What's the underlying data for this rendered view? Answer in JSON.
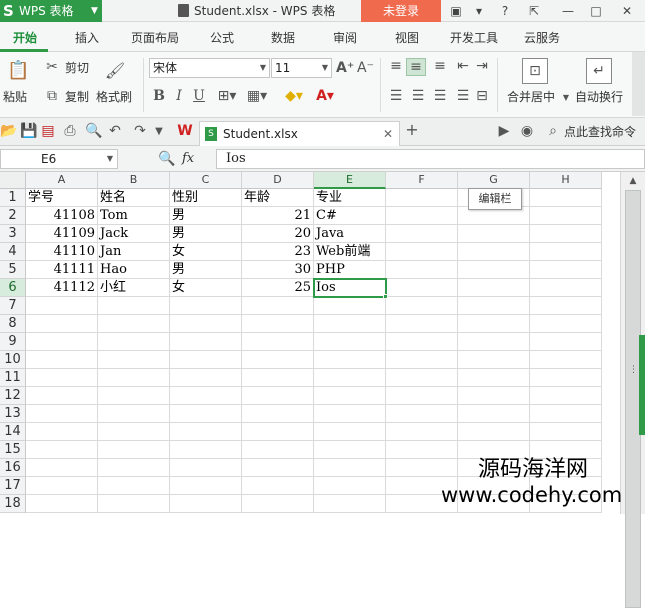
{
  "app": {
    "name": "WPS 表格",
    "logo_letter": "S",
    "window_title": "Student.xlsx - WPS 表格",
    "login_label": "未登录"
  },
  "tabs": [
    "开始",
    "插入",
    "页面布局",
    "公式",
    "数据",
    "审阅",
    "视图",
    "开发工具",
    "云服务"
  ],
  "ribbon": {
    "paste_label": "粘贴",
    "cut_label": "剪切",
    "copy_label": "复制",
    "format_painter_label": "格式刷",
    "font_name": "宋体",
    "font_size": "11",
    "merge_label": "合并居中",
    "wrap_label": "自动换行"
  },
  "quick_access": {
    "doc_tab_label": "Student.xlsx",
    "search_label": "点此查找命令"
  },
  "formula_bar": {
    "cell_ref": "E6",
    "fx_label": "fx",
    "value": "Ios"
  },
  "sheet": {
    "columns": [
      "A",
      "B",
      "C",
      "D",
      "E",
      "F",
      "G",
      "H"
    ],
    "rows": [
      "1",
      "2",
      "3",
      "4",
      "5",
      "6",
      "7",
      "8",
      "9",
      "10",
      "11",
      "12",
      "13",
      "14",
      "15",
      "16",
      "17",
      "18"
    ],
    "cells": [
      [
        "学号",
        "姓名",
        "性别",
        "年龄",
        "专业"
      ],
      [
        "41108",
        "Tom",
        "男",
        "21",
        "C#"
      ],
      [
        "41109",
        "Jack",
        "男",
        "20",
        "Java"
      ],
      [
        "41110",
        "Jan",
        "女",
        "23",
        "Web前端"
      ],
      [
        "41111",
        "Hao",
        "男",
        "30",
        "PHP"
      ],
      [
        "41112",
        "小红",
        "女",
        "25",
        "Ios"
      ]
    ],
    "active_cell": "E6"
  },
  "tooltip": "编辑栏",
  "watermark": {
    "line1": "源码海洋网",
    "line2": "www.codehy.com"
  }
}
